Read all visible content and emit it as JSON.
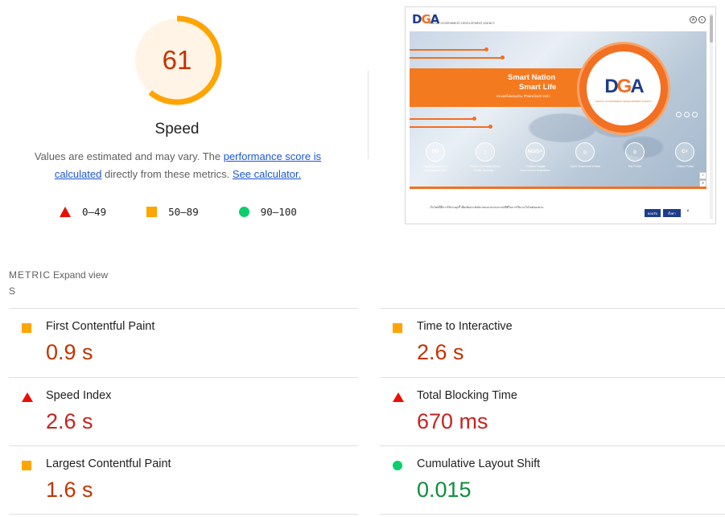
{
  "score": {
    "value": "61",
    "fraction": 0.61,
    "label": "Speed",
    "ring_color": "#ffa400",
    "bg_color": "#fff4e5",
    "text_color": "#c33300"
  },
  "description": {
    "prefix": "Values are estimated and may vary. The ",
    "link1": "performance score is calculated",
    "middle": " directly from these metrics. ",
    "link2": "See calculator."
  },
  "legend": [
    {
      "icon": "fail-triangle-icon",
      "range": "0–49",
      "color": "#eb0f00"
    },
    {
      "icon": "average-square-icon",
      "range": "50–89",
      "color": "#ffa400"
    },
    {
      "icon": "pass-circle-icon",
      "range": "90–100",
      "color": "#0cce6b"
    }
  ],
  "thumbnail": {
    "logo": "DGA",
    "logo_subtitle": "DIGITAL GOVERNMENT DEVELOPMENT AGENCY",
    "headline1": "Smart Nation",
    "headline2": "Smart Life",
    "headline_sub": "ประเทศไทยอัจฉริยะ ชีวิตคนไทยก้าวหน้า",
    "circle_logo": "DGA",
    "icons": [
      {
        "label": "DG",
        "caption": "Digital Government Development Plan"
      },
      {
        "label": "▯",
        "caption": "Govern Certainty Act on Public Security ..."
      },
      {
        "label": "NO/D+",
        "caption": "Thailand Digital Government Acquisition"
      },
      {
        "label": "◎",
        "caption": "Open Government Data"
      },
      {
        "label": "⊙",
        "caption": "Biz Portal"
      },
      {
        "label": "C+",
        "caption": "Citizen Portal"
      }
    ],
    "cookie_text": "เว็บไซต์นี้มีการใช้งานคุกกี้ เพื่อเพิ่มประสิทธิภาพและประสบการณ์ที่ดีในการใช้งานเว็บไซต์ของท่าน",
    "cookie_accept": "ยอมรับ",
    "cookie_settings": "ตั้งค่า",
    "cookie_close": "×"
  },
  "metrics_header": {
    "title": "METRIC",
    "title_tail": "S",
    "expand": "Expand view"
  },
  "metrics": [
    {
      "name": "First Contentful Paint",
      "value": "0.9 s",
      "rating": "average",
      "icon": "average-square-icon"
    },
    {
      "name": "Time to Interactive",
      "value": "2.6 s",
      "rating": "average",
      "icon": "average-square-icon"
    },
    {
      "name": "Speed Index",
      "value": "2.6 s",
      "rating": "fail",
      "icon": "fail-triangle-icon"
    },
    {
      "name": "Total Blocking Time",
      "value": "670 ms",
      "rating": "fail",
      "icon": "fail-triangle-icon"
    },
    {
      "name": "Largest Contentful Paint",
      "value": "1.6 s",
      "rating": "average",
      "icon": "average-square-icon"
    },
    {
      "name": "Cumulative Layout Shift",
      "value": "0.015",
      "rating": "pass",
      "icon": "pass-circle-icon"
    }
  ],
  "colors": {
    "fail": "#eb0f00",
    "average": "#ffa400",
    "pass": "#0cce6b",
    "link": "#1a56d6"
  }
}
